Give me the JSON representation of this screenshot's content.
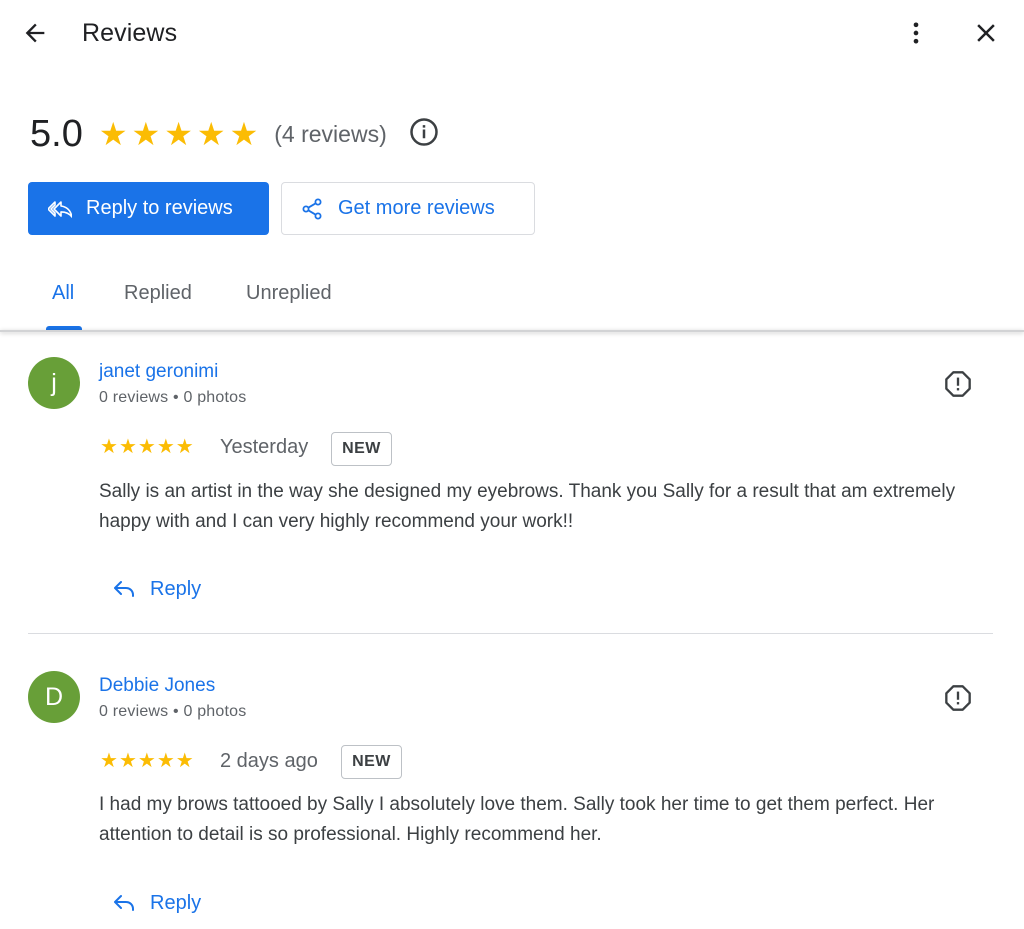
{
  "header": {
    "title": "Reviews"
  },
  "summary": {
    "rating": "5.0",
    "stars": 5,
    "review_count": "(4 reviews)"
  },
  "actions": {
    "reply_label": "Reply to reviews",
    "get_more_label": "Get more reviews"
  },
  "tabs": [
    {
      "label": "All",
      "active": true
    },
    {
      "label": "Replied",
      "active": false
    },
    {
      "label": "Unreplied",
      "active": false
    }
  ],
  "reviews": [
    {
      "initial": "j",
      "name": "janet geronimi",
      "meta": "0 reviews • 0 photos",
      "stars": 5,
      "date": "Yesterday",
      "badge": "NEW",
      "text": "Sally is an artist in the way she designed my eyebrows. Thank you Sally for a result that am extremely happy with and I can very highly recommend your work!!",
      "reply_label": "Reply"
    },
    {
      "initial": "D",
      "name": "Debbie Jones",
      "meta": "0 reviews • 0 photos",
      "stars": 5,
      "date": "2 days ago",
      "badge": "NEW",
      "text": "I had my brows tattooed by Sally I absolutely love them. Sally took her time to get them perfect. Her attention to detail is so professional. Highly recommend her.",
      "reply_label": "Reply"
    }
  ],
  "colors": {
    "accent": "#1a73e8",
    "star": "#fbbc04",
    "avatar": "#689f38"
  }
}
